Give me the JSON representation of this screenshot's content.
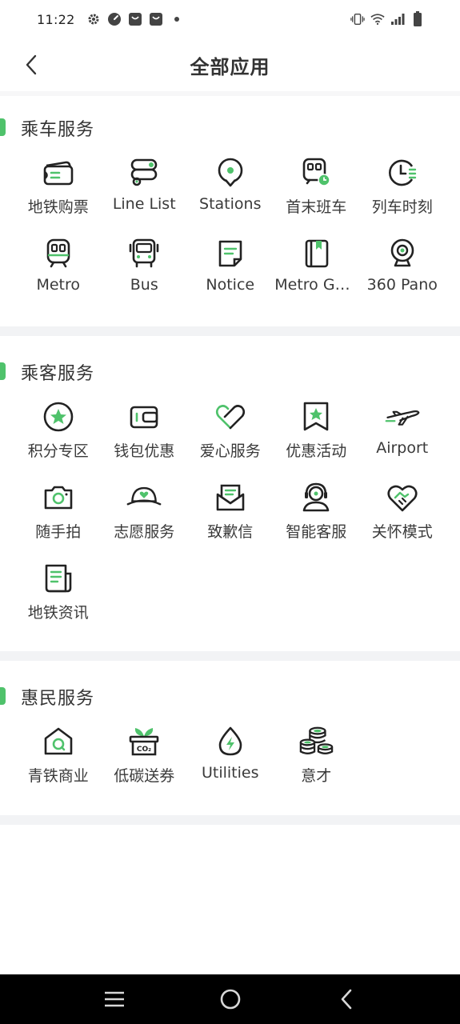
{
  "status_bar": {
    "time": "11:22"
  },
  "header": {
    "title": "全部应用"
  },
  "colors": {
    "accent": "#4fc26b",
    "icon_stroke": "#222222",
    "divider": "#f2f3f5"
  },
  "sections": [
    {
      "title": "乘车服务",
      "items": [
        {
          "label": "地铁购票",
          "icon": "ticket-icon"
        },
        {
          "label": "Line List",
          "icon": "route-icon"
        },
        {
          "label": "Stations",
          "icon": "location-pin-icon"
        },
        {
          "label": "首末班车",
          "icon": "train-clock-icon"
        },
        {
          "label": "列车时刻",
          "icon": "timetable-clock-icon"
        },
        {
          "label": "Metro",
          "icon": "metro-train-icon"
        },
        {
          "label": "Bus",
          "icon": "bus-icon"
        },
        {
          "label": "Notice",
          "icon": "notice-note-icon"
        },
        {
          "label": "Metro Gui...",
          "icon": "guide-book-icon"
        },
        {
          "label": "360 Pano",
          "icon": "panorama-camera-icon"
        }
      ]
    },
    {
      "title": "乘客服务",
      "items": [
        {
          "label": "积分专区",
          "icon": "star-badge-icon"
        },
        {
          "label": "钱包优惠",
          "icon": "wallet-icon"
        },
        {
          "label": "爱心服务",
          "icon": "heart-icon"
        },
        {
          "label": "优惠活动",
          "icon": "bookmark-star-icon"
        },
        {
          "label": "Airport",
          "icon": "airplane-icon"
        },
        {
          "label": "随手拍",
          "icon": "camera-icon"
        },
        {
          "label": "志愿服务",
          "icon": "volunteer-cap-icon"
        },
        {
          "label": "致歉信",
          "icon": "letter-icon"
        },
        {
          "label": "智能客服",
          "icon": "headset-agent-icon"
        },
        {
          "label": "关怀模式",
          "icon": "care-handshake-icon"
        },
        {
          "label": "地铁资讯",
          "icon": "news-icon"
        }
      ]
    },
    {
      "title": "惠民服务",
      "items": [
        {
          "label": "青铁商业",
          "icon": "shop-house-icon"
        },
        {
          "label": "低碳送券",
          "icon": "co2-plant-icon"
        },
        {
          "label": "Utilities",
          "icon": "energy-drop-icon"
        },
        {
          "label": "意才",
          "icon": "coins-stack-icon"
        }
      ]
    }
  ]
}
